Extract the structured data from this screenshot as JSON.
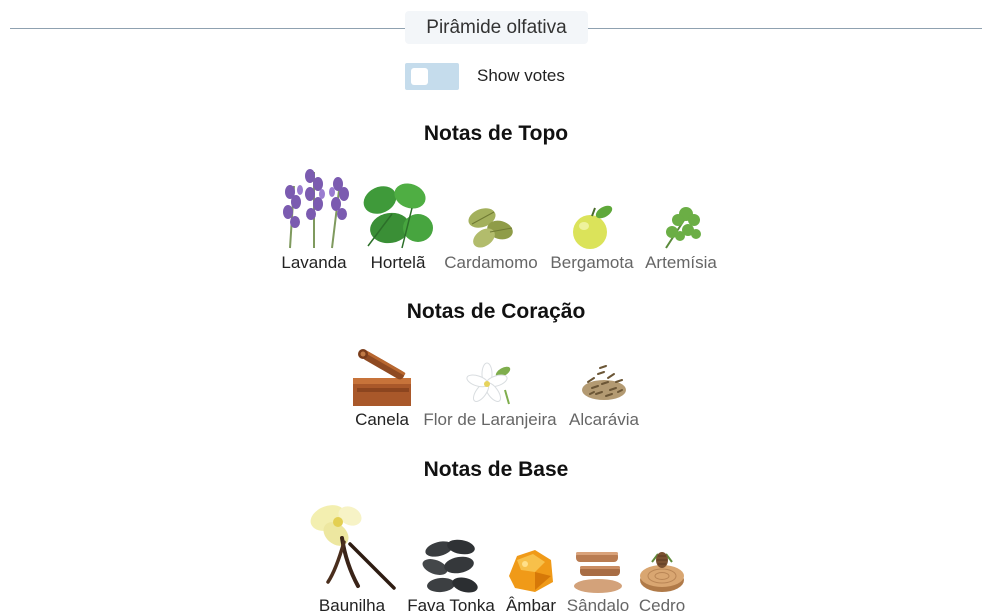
{
  "header": {
    "title": "Pirâmide olfativa"
  },
  "votes_toggle": {
    "label": "Show votes",
    "checked": false
  },
  "sections": [
    {
      "title": "Notas de Topo",
      "notes": [
        {
          "label": "Lavanda",
          "icon": "lavender-icon"
        },
        {
          "label": "Hortelã",
          "icon": "mint-icon"
        },
        {
          "label": "Cardamomo",
          "icon": "cardamom-icon"
        },
        {
          "label": "Bergamota",
          "icon": "bergamot-icon"
        },
        {
          "label": "Artemísia",
          "icon": "artemisia-icon"
        }
      ]
    },
    {
      "title": "Notas de Coração",
      "notes": [
        {
          "label": "Canela",
          "icon": "cinnamon-icon"
        },
        {
          "label": "Flor de Laranjeira",
          "icon": "orange-blossom-icon"
        },
        {
          "label": "Alcarávia",
          "icon": "caraway-icon"
        }
      ]
    },
    {
      "title": "Notas de Base",
      "notes": [
        {
          "label": "Baunilha",
          "icon": "vanilla-icon"
        },
        {
          "label": "Fava Tonka",
          "icon": "tonka-bean-icon"
        },
        {
          "label": "Âmbar",
          "icon": "amber-icon"
        },
        {
          "label": "Sândalo",
          "icon": "sandalwood-icon"
        },
        {
          "label": "Cedro",
          "icon": "cedar-icon"
        }
      ]
    }
  ]
}
